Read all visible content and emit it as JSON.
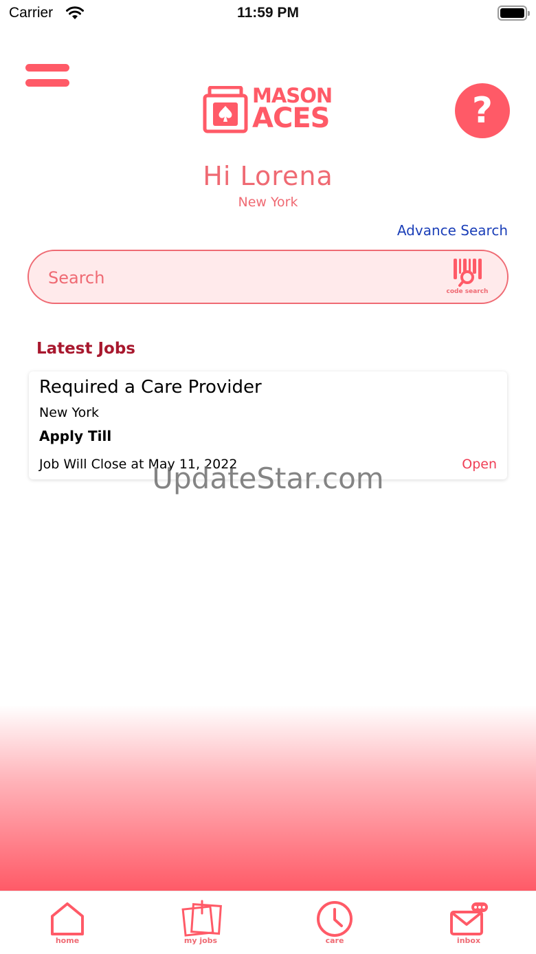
{
  "status_bar": {
    "carrier": "Carrier",
    "time": "11:59 PM"
  },
  "header": {
    "logo_line1": "MASON",
    "logo_line2": "ACES",
    "help_label": "?"
  },
  "user": {
    "greeting": "Hi Lorena",
    "location": "New York"
  },
  "search": {
    "advance_link": "Advance Search",
    "placeholder": "Search",
    "code_search_label": "code search"
  },
  "latest_jobs": {
    "title": "Latest Jobs",
    "jobs": [
      {
        "title": "Required a Care Provider",
        "location": "New York",
        "apply_label": "Apply Till",
        "close_text": "Job Will Close at May 11, 2022",
        "status": "Open"
      }
    ]
  },
  "watermark": "UpdateStar.com",
  "tab_bar": {
    "tabs": [
      {
        "label": "home",
        "icon": "home-icon"
      },
      {
        "label": "my jobs",
        "icon": "notes-icon"
      },
      {
        "label": "care",
        "icon": "clock-icon"
      },
      {
        "label": "inbox",
        "icon": "mail-icon"
      }
    ]
  },
  "colors": {
    "accent": "#ff5a67",
    "link": "#1b3fb8",
    "section_title": "#a8182e",
    "status_open": "#ef3e55"
  }
}
